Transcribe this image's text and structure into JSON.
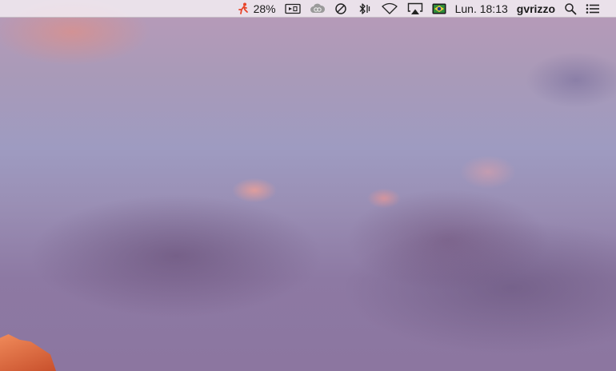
{
  "menubar": {
    "battery_percent": "28%",
    "clock": "Lun. 18:13",
    "username": "gvrizzo",
    "status_icons": [
      "running-figure-icon",
      "camera-icon",
      "creative-cloud-icon",
      "do-not-disturb-icon",
      "bluetooth-icon",
      "wifi-icon",
      "airplay-icon",
      "brazil-flag-icon",
      "spotlight-search-icon",
      "notification-center-icon"
    ]
  },
  "colors": {
    "menubar_bg": "#f5f0f5",
    "sky_top": "#b99ab8",
    "sky_bottom": "#8c76a0",
    "rock": "#e8703f"
  }
}
